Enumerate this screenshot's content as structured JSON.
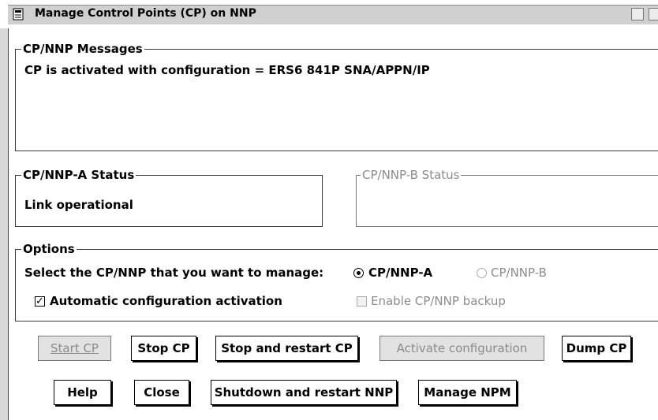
{
  "window": {
    "title": "Manage Control Points (CP) on NNP"
  },
  "messages": {
    "label": "CP/NNP Messages",
    "text": "CP is activated with configuration = ERS6 841P SNA/APPN/IP"
  },
  "status_a": {
    "label": "CP/NNP-A Status",
    "text": "Link operational"
  },
  "status_b": {
    "label": "CP/NNP-B Status",
    "text": ""
  },
  "options": {
    "label": "Options",
    "select_prompt": "Select the CP/NNP that you want to manage:",
    "radio_a_label": "CP/NNP-A",
    "radio_a_selected": true,
    "radio_b_label": "CP/NNP-B",
    "radio_b_enabled": false,
    "auto_activation_label": "Automatic configuration activation",
    "auto_activation_checked": true,
    "backup_label": "Enable CP/NNP backup",
    "backup_enabled": false
  },
  "buttons": {
    "start_cp": "Start CP",
    "stop_cp": "Stop CP",
    "stop_restart_cp": "Stop and restart CP",
    "activate_config": "Activate configuration",
    "dump_cp": "Dump CP",
    "help": "Help",
    "close": "Close",
    "shutdown_restart": "Shutdown and restart NNP",
    "manage_npm": "Manage NPM"
  },
  "icons": {
    "system_menu": "system-menu-icon",
    "minimize": "minimize-icon",
    "maximize": "maximize-icon"
  }
}
